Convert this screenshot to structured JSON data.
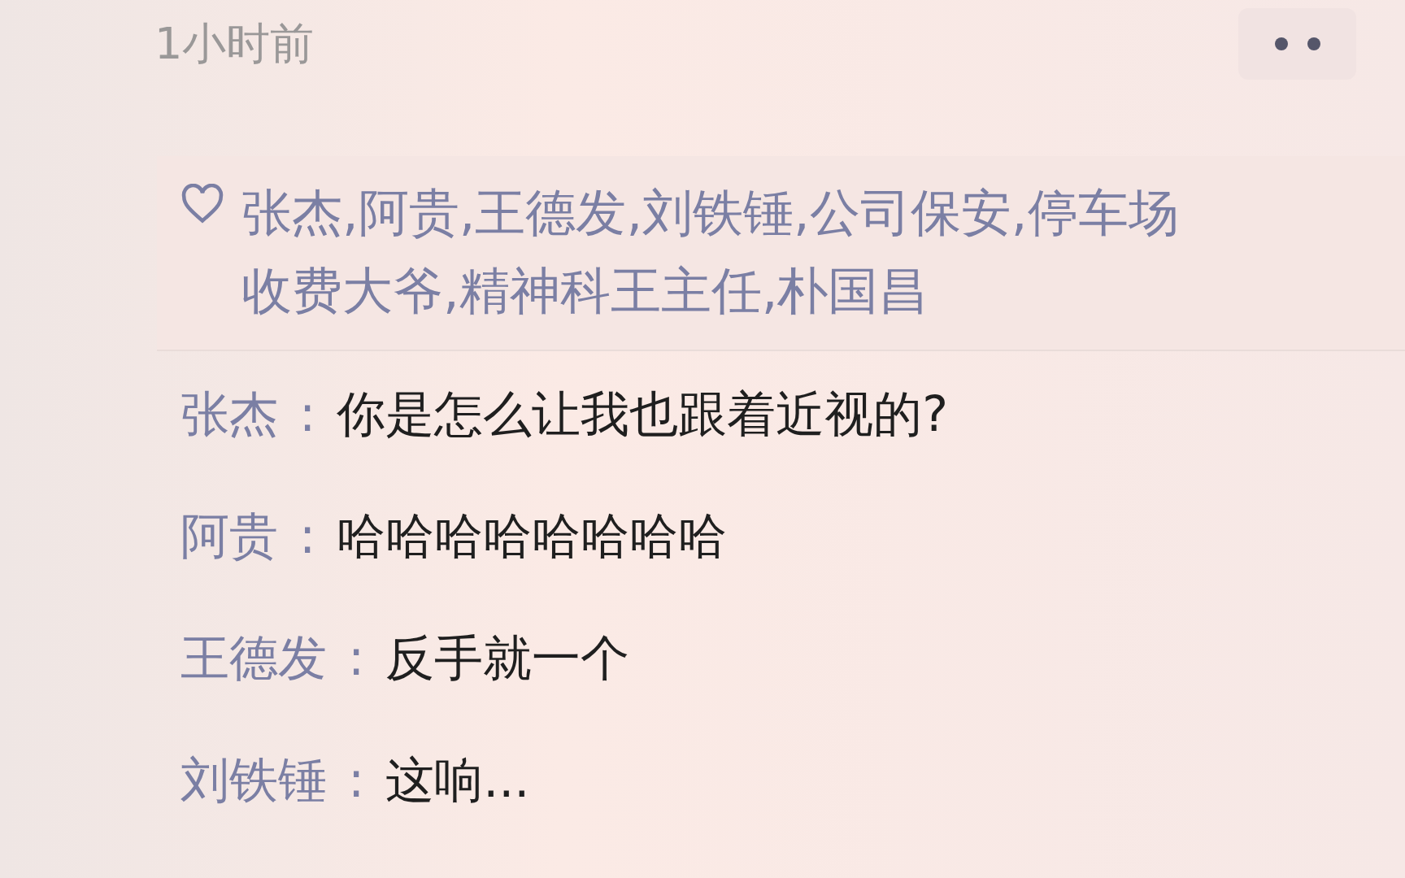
{
  "timestamp": "1小时前",
  "likes": {
    "names": "张杰,阿贵,王德发,刘铁锤,公司保安,停车场收费大爷,精神科王主任,朴国昌"
  },
  "comments": [
    {
      "author": "张杰",
      "separator": ":",
      "text": "你是怎么让我也跟着近视的?"
    },
    {
      "author": "阿贵",
      "separator": ":",
      "text": "哈哈哈哈哈哈哈哈"
    },
    {
      "author": "王德发",
      "separator": ":",
      "text": "反手就一个"
    },
    {
      "author": "刘铁锤",
      "separator": ":",
      "text": "这响..."
    }
  ]
}
